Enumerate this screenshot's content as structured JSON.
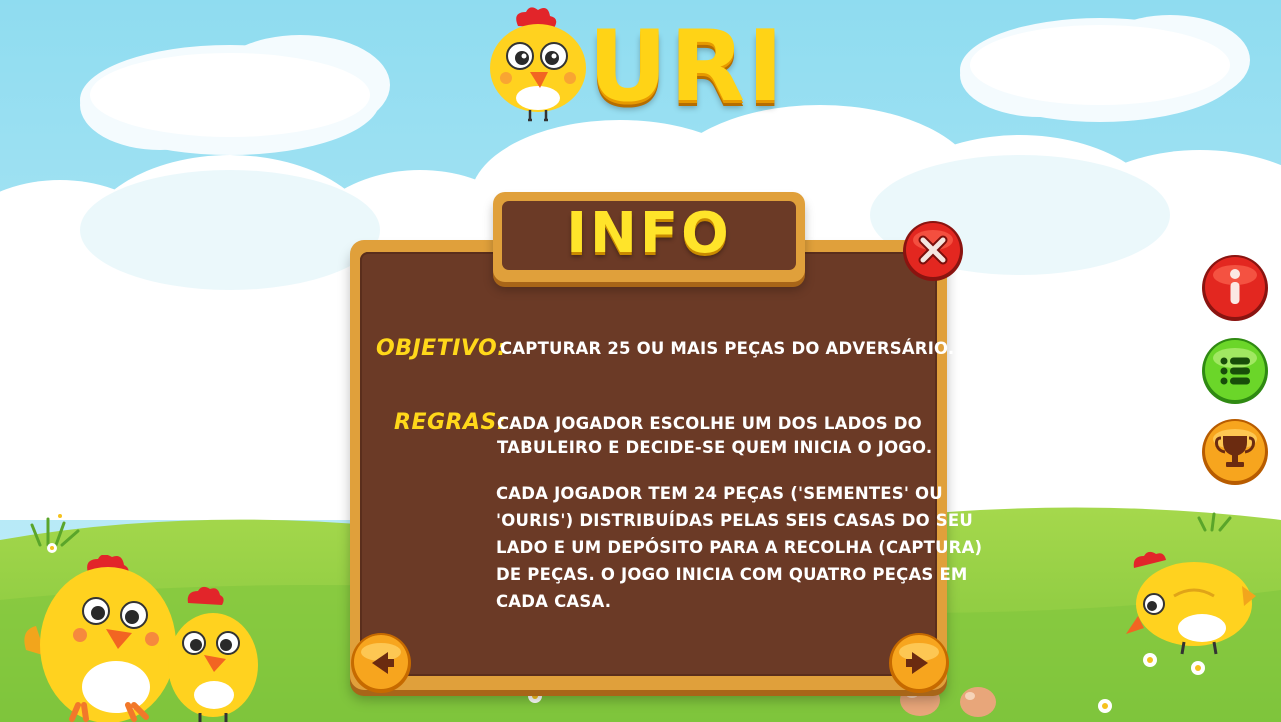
{
  "logo": {
    "text": "URI"
  },
  "panel": {
    "title": "INFO",
    "objetivo_label": "OBJETIVO:",
    "objetivo_text": "CAPTURAR 25 OU MAIS PEÇAS DO ADVERSÁRIO.",
    "regras_label": "REGRAS:",
    "regras_line1": "CADA JOGADOR ESCOLHE UM DOS LADOS DO",
    "regras_line2": "TABULEIRO E DECIDE-SE QUEM INICIA O JOGO.",
    "para2_line1": "CADA JOGADOR TEM 24 PEÇAS ('SEMENTES' OU",
    "para2_line2": "'OURIS') DISTRIBUÍDAS PELAS SEIS CASAS DO SEU",
    "para2_line3": "LADO E UM DEPÓSITO PARA A RECOLHA (CAPTURA)",
    "para2_line4": "DE PEÇAS. O JOGO INICIA COM QUATRO PEÇAS EM",
    "para2_line5": "CADA CASA."
  },
  "buttons": {
    "close": "close-icon",
    "prev": "arrow-left-icon",
    "next": "arrow-right-icon",
    "info": "info-icon",
    "menu": "list-icon",
    "trophy": "trophy-icon"
  },
  "colors": {
    "sky": "#9fe3f4",
    "grass": "#8fcf43",
    "board_frame": "#e0a03b",
    "board_fill": "#6b3a26",
    "label_yellow": "#ffd81a",
    "close_red": "#e32720",
    "menu_green": "#6bd629",
    "trophy_orange": "#f7a51e"
  }
}
